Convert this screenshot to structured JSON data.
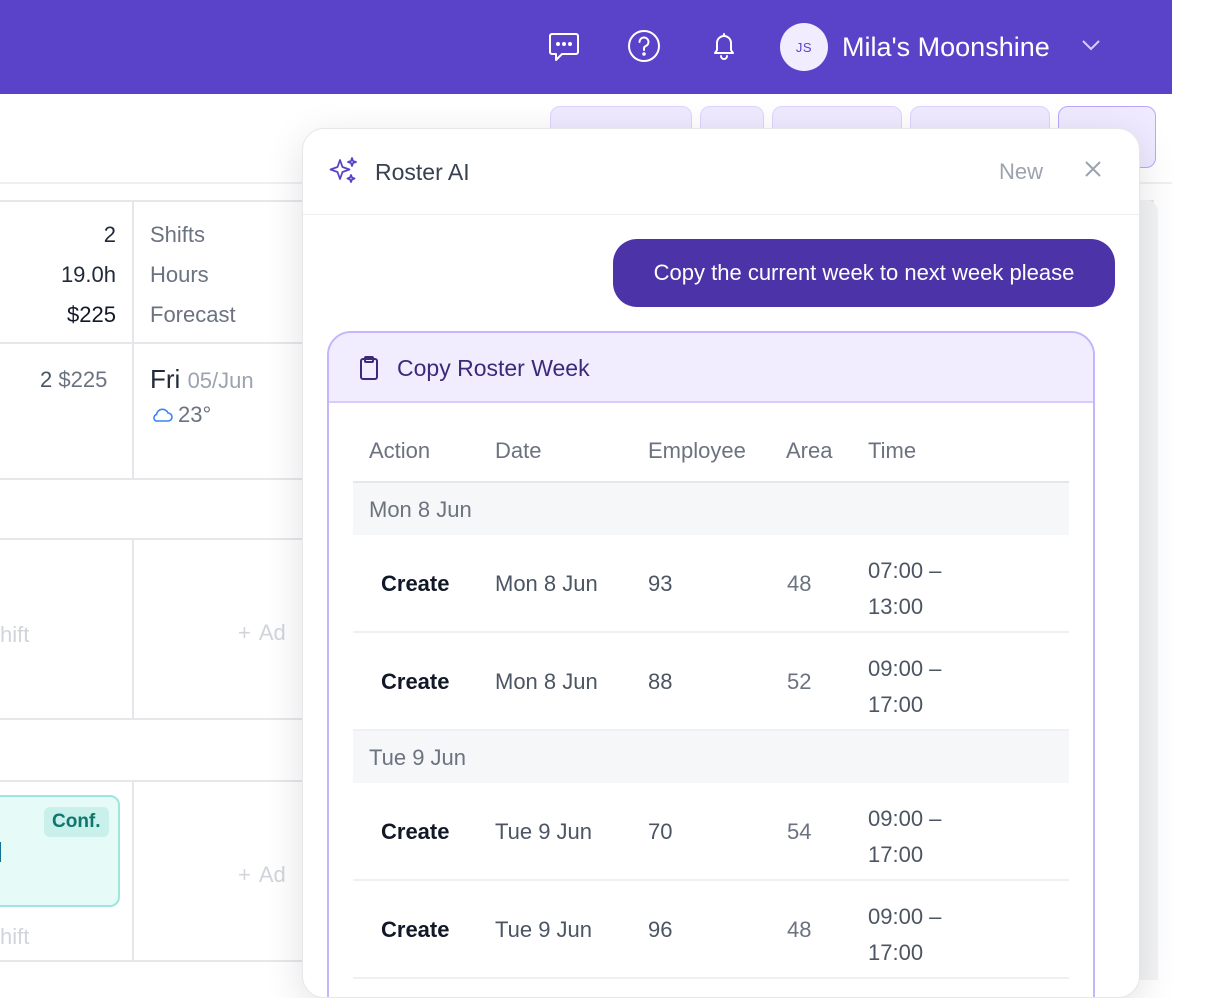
{
  "topbar": {
    "icons": [
      "chat-icon",
      "help-icon",
      "bell-icon"
    ],
    "avatar_initials": "JS",
    "user_name": "Mila's Moonshine",
    "accent": "#5b43c9"
  },
  "roster": {
    "stats": [
      {
        "value": "2",
        "label": "Shifts"
      },
      {
        "value": "19.0h",
        "label": "Hours"
      },
      {
        "value": "$225",
        "label": "Forecast"
      }
    ],
    "day_summary": {
      "shifts": "2",
      "cost": "$225"
    },
    "day": {
      "name": "Fri",
      "date": "05/Jun",
      "temp": "23°"
    },
    "add_shift_fragment": "hift",
    "add_label_fragment": "Ad",
    "shift_badge": "Conf."
  },
  "panel": {
    "title": "Roster AI",
    "new_label": "New",
    "user_message": "Copy the current week to next week please",
    "card": {
      "title": "Copy Roster Week",
      "columns": [
        "Action",
        "Date",
        "Employee",
        "Area",
        "Time"
      ],
      "groups": [
        {
          "label": "Mon 8 Jun",
          "rows": [
            {
              "action": "Create",
              "date": "Mon 8 Jun",
              "employee": "93",
              "area": "48",
              "time_start": "07:00 –",
              "time_end": "13:00"
            },
            {
              "action": "Create",
              "date": "Mon 8 Jun",
              "employee": "88",
              "area": "52",
              "time_start": "09:00 –",
              "time_end": "17:00"
            }
          ]
        },
        {
          "label": "Tue 9 Jun",
          "rows": [
            {
              "action": "Create",
              "date": "Tue 9 Jun",
              "employee": "70",
              "area": "54",
              "time_start": "09:00 –",
              "time_end": "17:00"
            },
            {
              "action": "Create",
              "date": "Tue 9 Jun",
              "employee": "96",
              "area": "48",
              "time_start": "09:00 –",
              "time_end": "17:00"
            }
          ]
        }
      ]
    }
  }
}
